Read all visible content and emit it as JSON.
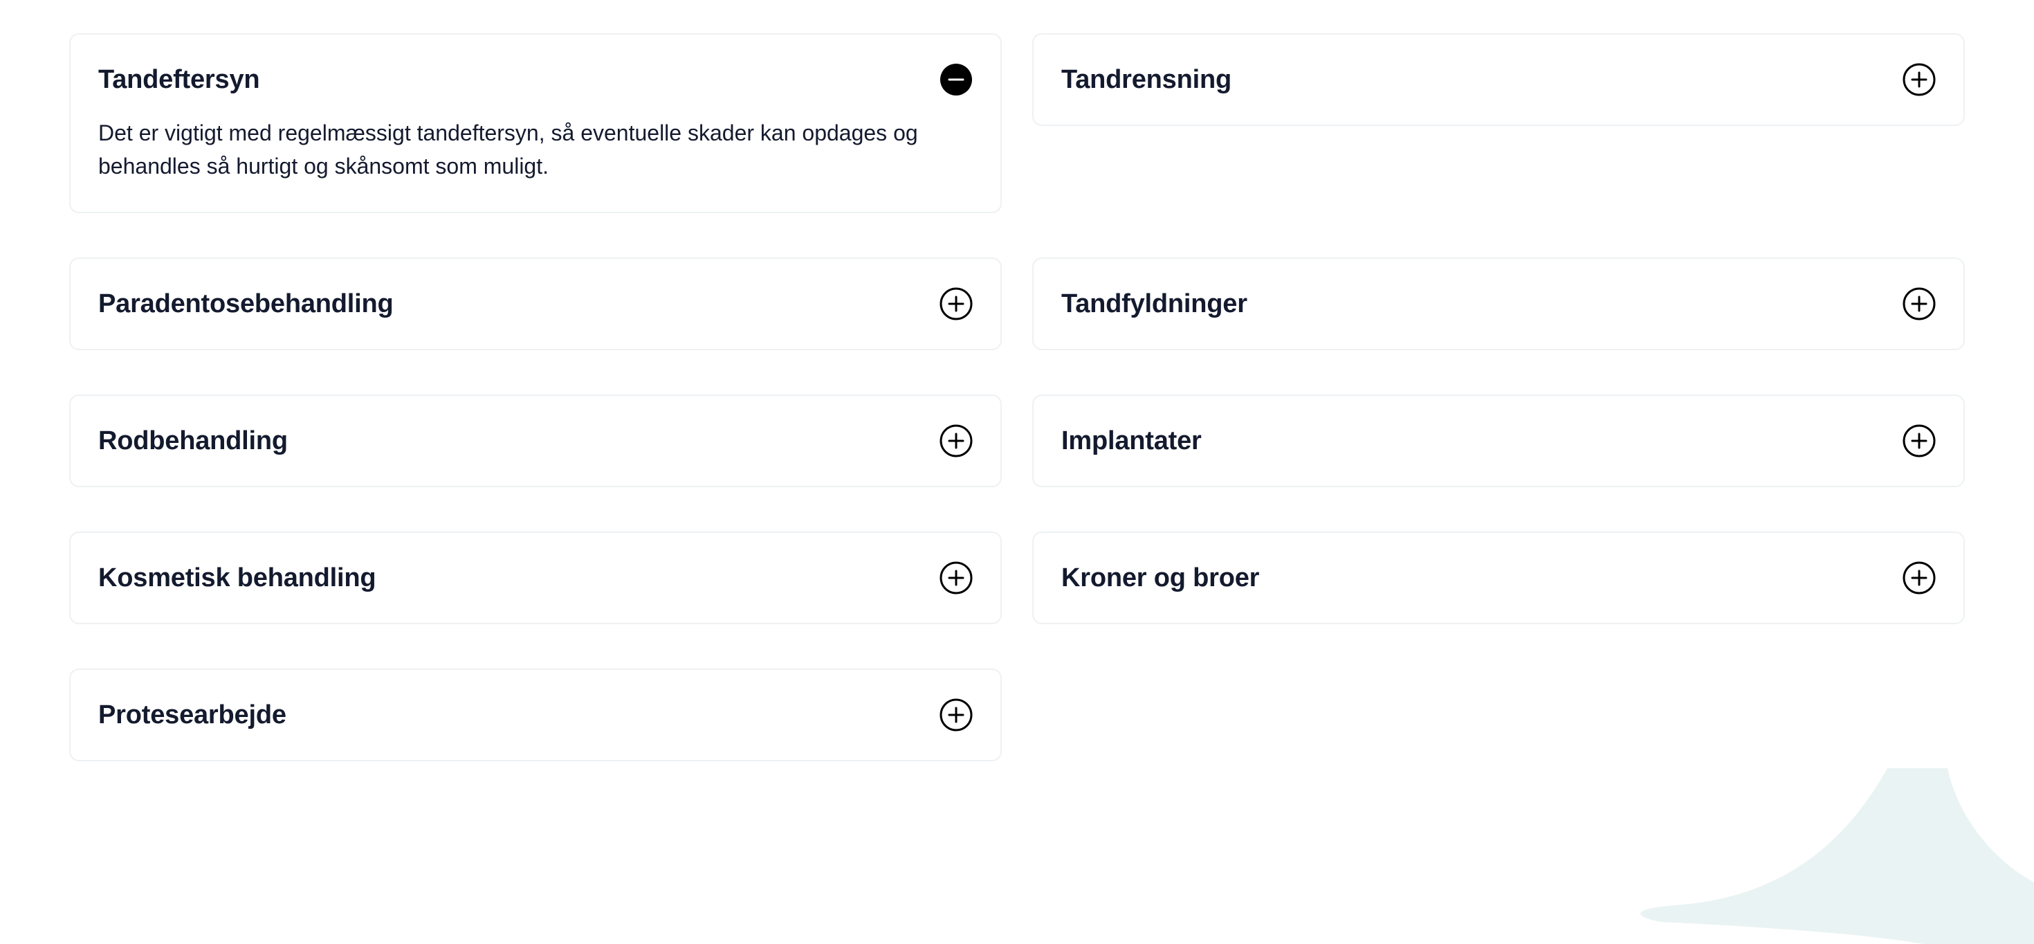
{
  "faq": {
    "items": [
      {
        "title": "Tandeftersyn",
        "expanded": true,
        "body": "Det er vigtigt med regelmæssigt tandeftersyn, så eventuelle skader kan opdages og behandles så hurtigt og skånsomt som muligt.",
        "icon": "minus-circle-icon"
      },
      {
        "title": "Tandrensning",
        "expanded": false,
        "icon": "plus-circle-icon"
      },
      {
        "title": "Paradentosebehandling",
        "expanded": false,
        "icon": "plus-circle-icon"
      },
      {
        "title": "Tandfyldninger",
        "expanded": false,
        "icon": "plus-circle-icon"
      },
      {
        "title": "Rodbehandling",
        "expanded": false,
        "icon": "plus-circle-icon"
      },
      {
        "title": "Implantater",
        "expanded": false,
        "icon": "plus-circle-icon"
      },
      {
        "title": "Kosmetisk behandling",
        "expanded": false,
        "icon": "plus-circle-icon"
      },
      {
        "title": "Kroner og broer",
        "expanded": false,
        "icon": "plus-circle-icon"
      },
      {
        "title": "Protesearbejde",
        "expanded": false,
        "icon": "plus-circle-icon"
      }
    ]
  },
  "colors": {
    "text": "#141a2e",
    "border": "#eef1f3",
    "decor": "#eaf3f3",
    "icon": "#000000"
  }
}
